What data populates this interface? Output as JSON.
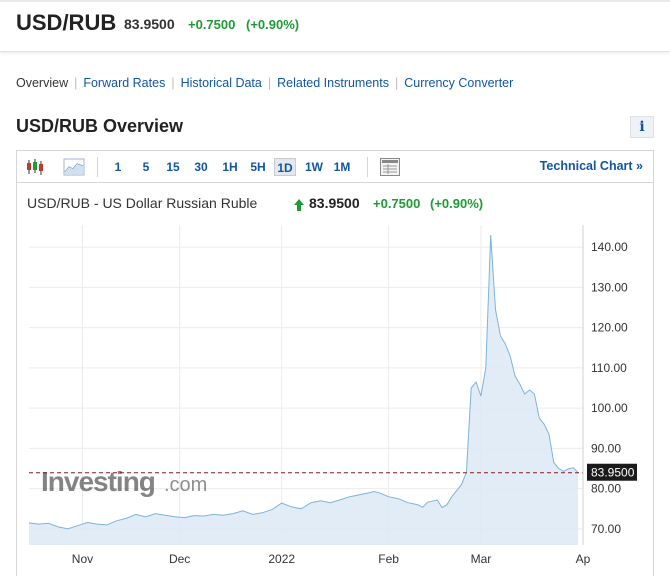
{
  "header": {
    "title": "USD/RUB",
    "price": "83.9500",
    "change": "+0.7500",
    "change_pct": "(+0.90%)"
  },
  "subnav": {
    "items": [
      {
        "label": "Overview",
        "active": true
      },
      {
        "label": "Forward Rates",
        "active": false
      },
      {
        "label": "Historical Data",
        "active": false
      },
      {
        "label": "Related Instruments",
        "active": false
      },
      {
        "label": "Currency Converter",
        "active": false
      }
    ],
    "separator": "|"
  },
  "overview": {
    "title": "USD/RUB Overview",
    "info_label": "i"
  },
  "toolbar": {
    "icons": [
      "candlestick-chart-icon",
      "area-chart-icon",
      "table-view-icon"
    ],
    "timeframes": [
      "1",
      "5",
      "15",
      "30",
      "1H",
      "5H",
      "1D",
      "1W",
      "1M"
    ],
    "active_timeframe": "1D",
    "technical_link": "Technical Chart »"
  },
  "chart_header": {
    "title": "USD/RUB - US Dollar Russian Ruble",
    "price": "83.9500",
    "change": "+0.7500",
    "change_pct": "(+0.90%)"
  },
  "watermark": {
    "brand": "Investing",
    "suffix": ".com"
  },
  "colors": {
    "accent": "#1256a0",
    "positive": "#1f9b35",
    "line": "#7fb3d8",
    "fill": "#dde9f4",
    "last_label_bg": "#1a1a1a",
    "last_line": "#8a1a1a"
  },
  "chart_data": {
    "type": "area",
    "last_value": 83.95,
    "last_label": "83.9500",
    "ylim": [
      66,
      144
    ],
    "y_ticks": [
      70,
      80,
      90,
      100,
      110,
      120,
      130,
      140
    ],
    "y_tick_labels": [
      "70.00",
      "80.00",
      "90.00",
      "100.00",
      "110.00",
      "120.00",
      "130.00",
      "140.00"
    ],
    "x_ticks": [
      {
        "label": "Nov",
        "t": 11
      },
      {
        "label": "Dec",
        "t": 31
      },
      {
        "label": "2022",
        "t": 52
      },
      {
        "label": "Feb",
        "t": 74
      },
      {
        "label": "Mar",
        "t": 93
      },
      {
        "label": "Ap",
        "t": 114
      }
    ],
    "x_range": [
      0,
      114
    ],
    "series": [
      {
        "values": [
          [
            0,
            71.5
          ],
          [
            2,
            71.2
          ],
          [
            4,
            71.4
          ],
          [
            6,
            70.5
          ],
          [
            8,
            70.0
          ],
          [
            10,
            70.8
          ],
          [
            12,
            71.6
          ],
          [
            14,
            71.2
          ],
          [
            16,
            71.0
          ],
          [
            18,
            72.0
          ],
          [
            20,
            72.6
          ],
          [
            22,
            73.6
          ],
          [
            24,
            73.0
          ],
          [
            26,
            73.8
          ],
          [
            28,
            73.4
          ],
          [
            30,
            73.0
          ],
          [
            32,
            72.8
          ],
          [
            34,
            73.3
          ],
          [
            36,
            73.2
          ],
          [
            38,
            73.6
          ],
          [
            40,
            73.4
          ],
          [
            42,
            73.8
          ],
          [
            44,
            74.5
          ],
          [
            46,
            73.6
          ],
          [
            48,
            74.0
          ],
          [
            50,
            74.8
          ],
          [
            52,
            76.4
          ],
          [
            54,
            75.5
          ],
          [
            56,
            75.0
          ],
          [
            58,
            76.5
          ],
          [
            60,
            77.0
          ],
          [
            62,
            76.5
          ],
          [
            64,
            77.2
          ],
          [
            66,
            78.0
          ],
          [
            68,
            78.5
          ],
          [
            70,
            79.0
          ],
          [
            71,
            79.3
          ],
          [
            72,
            79.0
          ],
          [
            74,
            78.0
          ],
          [
            76,
            77.5
          ],
          [
            78,
            76.5
          ],
          [
            80,
            76.0
          ],
          [
            81,
            75.4
          ],
          [
            82,
            76.6
          ],
          [
            84,
            77.2
          ],
          [
            85,
            75.3
          ],
          [
            86,
            76.0
          ],
          [
            87,
            78.0
          ],
          [
            88,
            79.5
          ],
          [
            89,
            81.0
          ],
          [
            90,
            84.0
          ],
          [
            91,
            105.0
          ],
          [
            92,
            106.5
          ],
          [
            93,
            103.0
          ],
          [
            94,
            110.0
          ],
          [
            95,
            143.0
          ],
          [
            96,
            124.5
          ],
          [
            97,
            118.0
          ],
          [
            98,
            116.0
          ],
          [
            99,
            113.0
          ],
          [
            100,
            108.0
          ],
          [
            101,
            106.0
          ],
          [
            102,
            103.5
          ],
          [
            103,
            104.5
          ],
          [
            104,
            103.5
          ],
          [
            105,
            97.5
          ],
          [
            106,
            96.0
          ],
          [
            107,
            93.5
          ],
          [
            108,
            86.5
          ],
          [
            109,
            85.0
          ],
          [
            110,
            84.3
          ],
          [
            111,
            84.9
          ],
          [
            112,
            85.2
          ],
          [
            113,
            83.95
          ]
        ]
      }
    ],
    "grid": true
  }
}
